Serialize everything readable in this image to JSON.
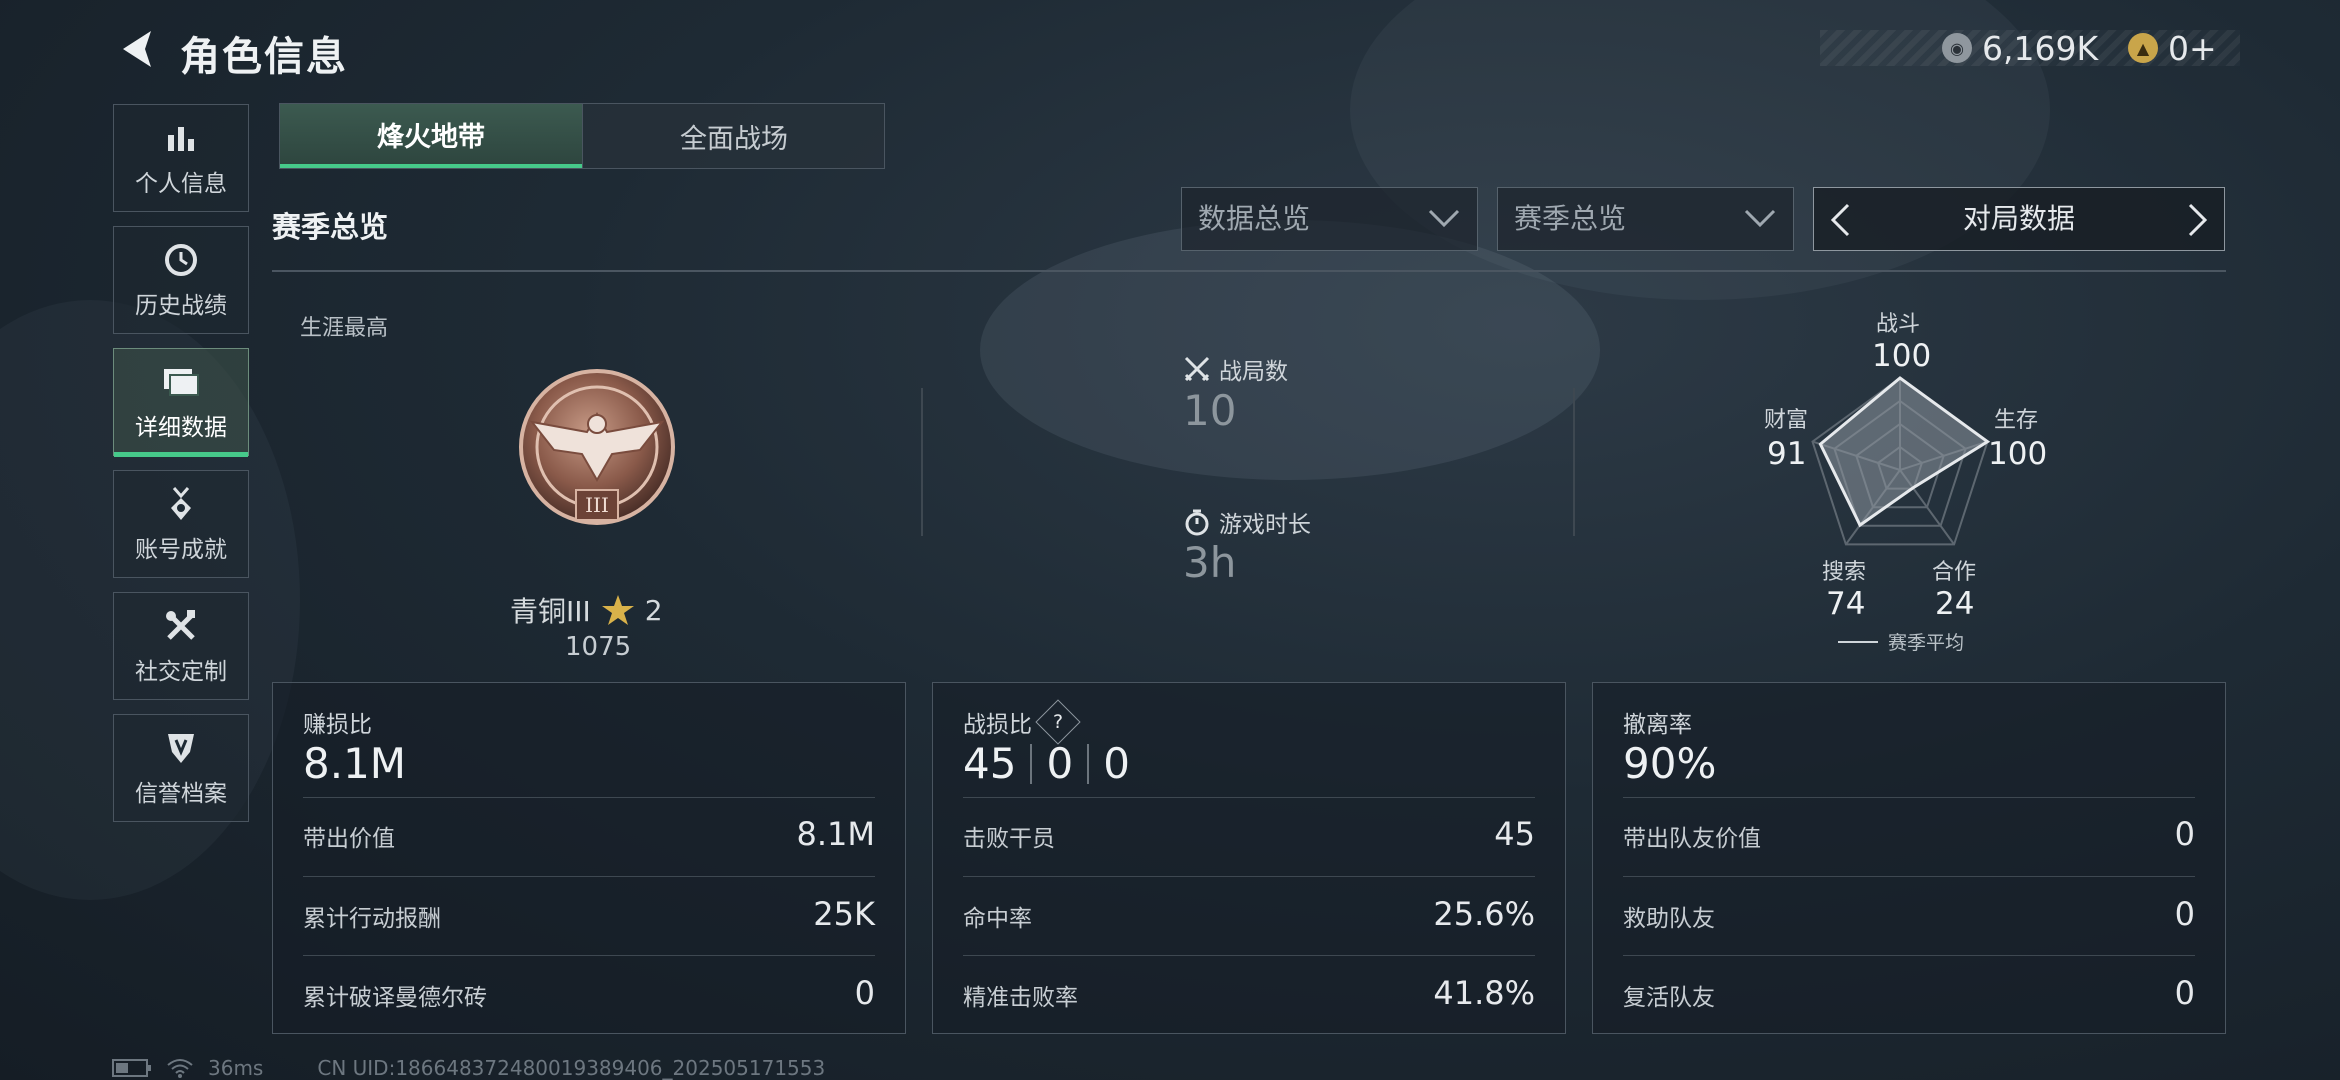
{
  "header": {
    "title": "角色信息",
    "currency_silver": "6,169K",
    "currency_gold": "0+"
  },
  "sidebar": {
    "items": [
      {
        "label": "个人信息",
        "icon": "bar-chart-icon"
      },
      {
        "label": "历史战绩",
        "icon": "clock-icon"
      },
      {
        "label": "详细数据",
        "icon": "folder-icon",
        "active": true
      },
      {
        "label": "账号成就",
        "icon": "medal-icon"
      },
      {
        "label": "社交定制",
        "icon": "tools-icon"
      },
      {
        "label": "信誉档案",
        "icon": "shield-icon"
      }
    ]
  },
  "tabs": [
    {
      "label": "烽火地带",
      "active": true
    },
    {
      "label": "全面战场",
      "active": false
    }
  ],
  "filters": {
    "section_title": "赛季总览",
    "select_1": "数据总览",
    "select_2": "赛季总览",
    "pager_label": "对局数据"
  },
  "overview": {
    "career_best_label": "生涯最高",
    "rank_name": "青铜III",
    "rank_stars": "2",
    "rank_score": "1075",
    "rank_badge_numeral": "III",
    "matches_label": "战局数",
    "matches_value": "10",
    "playtime_label": "游戏时长",
    "playtime_value": "3h"
  },
  "radar": {
    "axes": [
      {
        "label": "战斗",
        "value": "100"
      },
      {
        "label": "生存",
        "value": "100"
      },
      {
        "label": "合作",
        "value": "24"
      },
      {
        "label": "搜索",
        "value": "74"
      },
      {
        "label": "财富",
        "value": "91"
      }
    ],
    "scores": [
      100,
      100,
      24,
      74,
      91
    ],
    "legend": "赛季平均"
  },
  "cards": [
    {
      "head": "赚损比",
      "big": "8.1M",
      "rows": [
        {
          "k": "带出价值",
          "v": "8.1M"
        },
        {
          "k": "累计行动报酬",
          "v": "25K"
        },
        {
          "k": "累计破译曼德尔砖",
          "v": "0"
        }
      ]
    },
    {
      "head": "战损比",
      "help": "?",
      "big_parts": [
        "45",
        "0",
        "0"
      ],
      "rows": [
        {
          "k": "击败干员",
          "v": "45"
        },
        {
          "k": "命中率",
          "v": "25.6%"
        },
        {
          "k": "精准击败率",
          "v": "41.8%"
        }
      ]
    },
    {
      "head": "撤离率",
      "big": "90%",
      "rows": [
        {
          "k": "带出队友价值",
          "v": "0"
        },
        {
          "k": "救助队友",
          "v": "0"
        },
        {
          "k": "复活队友",
          "v": "0"
        }
      ]
    }
  ],
  "footer": {
    "ping": "36ms",
    "uid": "CN UID:18664837248001938​9406_202505171553"
  },
  "colors": {
    "accent": "#46c98a",
    "radar_fill": "#8c969e"
  }
}
